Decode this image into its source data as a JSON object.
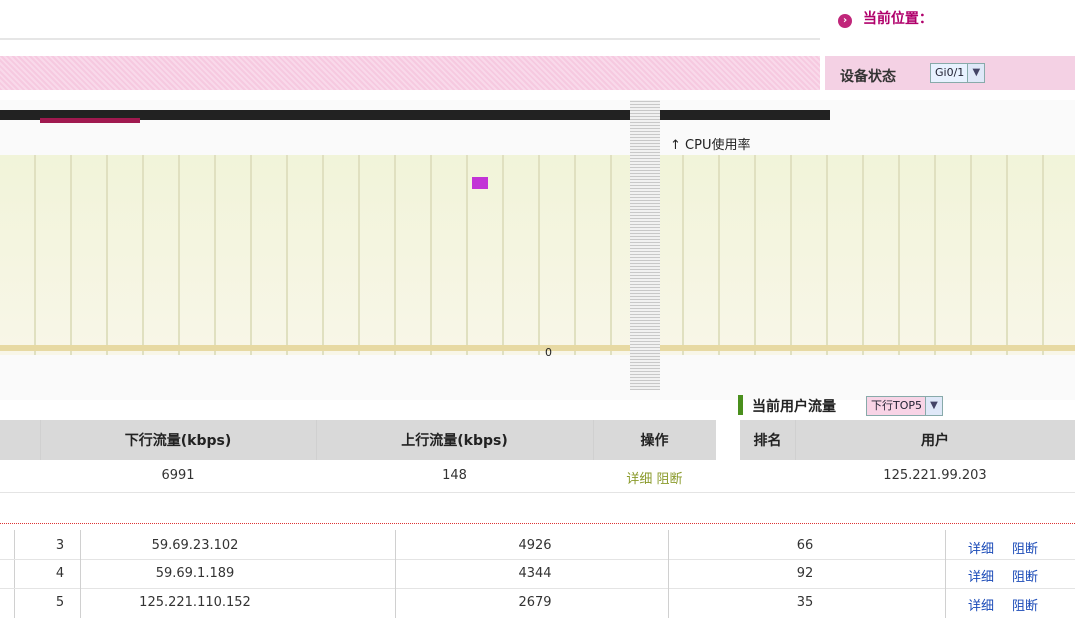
{
  "location": {
    "label": "当前位置：",
    "icon": "arrow-right-circle-icon"
  },
  "device_status": {
    "label": "设备状态",
    "selected": "Gi0/1"
  },
  "chart": {
    "label": "↑ CPU使用率",
    "zero_tick": "0"
  },
  "user_flow": {
    "title": "当前用户流量",
    "selected": "下行TOP5"
  },
  "table": {
    "headers": {
      "down": "下行流量(kbps)",
      "up": "上行流量(kbps)",
      "ops": "操作",
      "rank": "排名",
      "user": "用户"
    },
    "top_row": {
      "down": "6991",
      "up": "148",
      "ops": "详细 阻断",
      "user": "125.221.99.203"
    },
    "rows": [
      {
        "rank": "3",
        "user": "59.69.23.102",
        "down": "4926",
        "up": "66",
        "detail": "详细",
        "block": "阻断"
      },
      {
        "rank": "4",
        "user": "59.69.1.189",
        "down": "4344",
        "up": "92",
        "detail": "详细",
        "block": "阻断"
      },
      {
        "rank": "5",
        "user": "125.221.110.152",
        "down": "2679",
        "up": "35",
        "detail": "详细",
        "block": "阻断"
      }
    ]
  },
  "colors": {
    "accent": "#b0006b",
    "link": "#1b4bb8"
  }
}
